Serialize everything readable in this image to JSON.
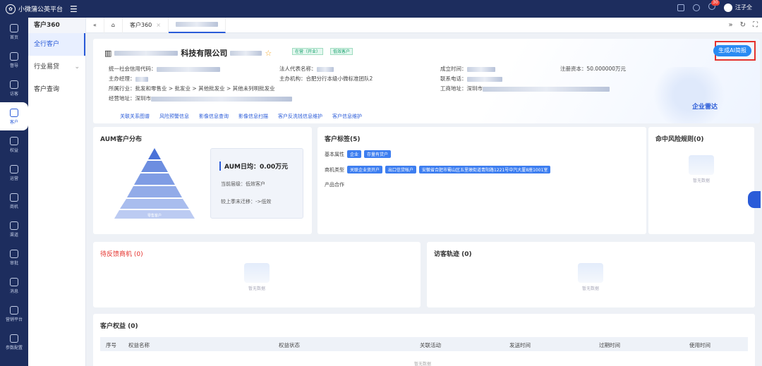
{
  "app": {
    "title": "小微蒲公英平台",
    "user": "汪子全",
    "notif_count": "30"
  },
  "nav": [
    {
      "label": "首页",
      "icon": "home-icon"
    },
    {
      "label": "督导",
      "icon": "clipboard-icon"
    },
    {
      "label": "访客",
      "icon": "visitor-icon"
    },
    {
      "label": "客户",
      "icon": "customer-icon",
      "active": true
    },
    {
      "label": "权益",
      "icon": "gift-icon"
    },
    {
      "label": "运营",
      "icon": "grid-icon"
    },
    {
      "label": "商机",
      "icon": "shop-icon"
    },
    {
      "label": "渠道",
      "icon": "network-icon"
    },
    {
      "label": "审批",
      "icon": "approve-icon"
    },
    {
      "label": "消息",
      "icon": "send-icon"
    },
    {
      "label": "营销平台",
      "icon": "marketing-icon"
    },
    {
      "label": "参数配置",
      "icon": "settings-icon"
    }
  ],
  "submenu": {
    "title": "客户360",
    "items": [
      "全行客户",
      "行业易贷",
      "客户查询"
    ]
  },
  "tabs": {
    "home_icon": "home-icon",
    "items": [
      "客户360"
    ]
  },
  "company": {
    "name_suffix": "科技有限公司",
    "status_tag": "在营（开业）",
    "type_tag": "低效客户",
    "gen_button": "生成AI简报",
    "fields": {
      "credit_code": "统一社会信用代码：",
      "legal_rep": "法人代表名称：",
      "found_date": "成立时间：",
      "reg_capital": "注册资本：",
      "reg_capital_val": "50.000000万元",
      "manager": "主办经理：",
      "org": "主办机构：",
      "org_val": "合肥分行本级小微标准团队2",
      "phone": "联系电话：",
      "industry": "所属行业：",
      "industry_val": "批发和零售业 > 批发业 > 其他批发业 > 其他未列明批发业",
      "biz_addr": "工商地址：",
      "biz_addr_val": "深圳市",
      "op_addr": "经营地址：",
      "op_addr_val": "深圳市"
    },
    "links": [
      "关联关系图谱",
      "风险预警信息",
      "影像信息查询",
      "影像信息扫描",
      "客户反洗钱信息维护",
      "客户信息维护"
    ],
    "radar": "企业雷达"
  },
  "aum": {
    "title": "AUM客户分布",
    "pyramid_label": "零售客户",
    "daily_avg": "AUM日均：0.00万元",
    "level": "当前层级：低效客户",
    "migration": "较上季末迁移：->低效"
  },
  "tags": {
    "title": "客户标签(5)",
    "basic_label": "基本属性",
    "basic": [
      "企业",
      "存量有贷户"
    ],
    "biz_label": "商机类型",
    "biz": [
      "关联企业资开户",
      "出口信贷帐户",
      "安徽省合肥市蜀山区五里墩街道青阳路1221号中汽大厦8座1001室"
    ],
    "product_label": "产品合作"
  },
  "risk": {
    "title": "命中风险规则(0)",
    "empty": "暂无数据"
  },
  "pending": {
    "title": "待反馈商机",
    "count": "(0)",
    "empty": "暂无数据"
  },
  "visits": {
    "title": "访客轨迹",
    "count": "(0)",
    "empty": "暂无数据"
  },
  "rights": {
    "title": "客户权益",
    "count": "(0)",
    "columns": [
      "序号",
      "权益名称",
      "权益状态",
      "关联活动",
      "发送时间",
      "过期时间",
      "使用时间"
    ],
    "empty": "暂无数据"
  }
}
